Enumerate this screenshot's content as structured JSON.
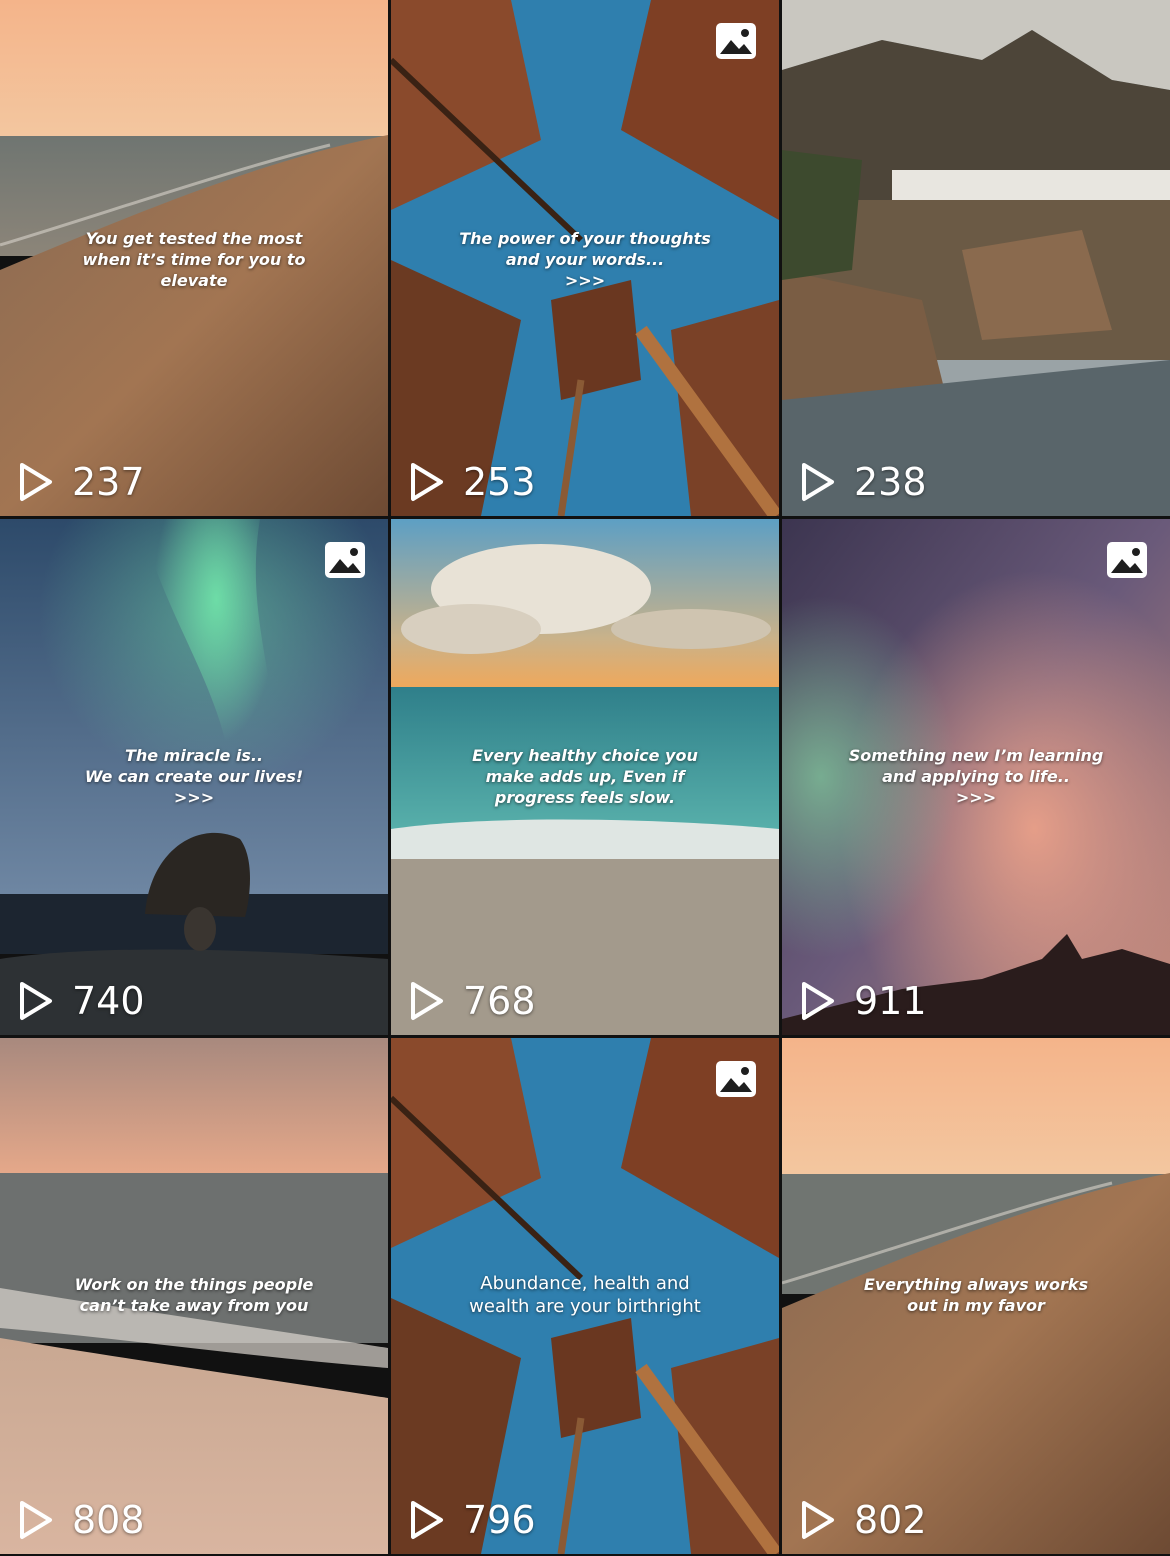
{
  "tiles": [
    {
      "caption": "You get tested the most\nwhen it’s time for you to\nelevate",
      "views": "237",
      "photo_badge": false
    },
    {
      "caption": "The power of your thoughts\nand your words...\n>>>",
      "views": "253",
      "photo_badge": true
    },
    {
      "caption": "",
      "views": "238",
      "photo_badge": false
    },
    {
      "caption": "The miracle is..\nWe can create our lives!\n>>>",
      "views": "740",
      "photo_badge": true
    },
    {
      "caption": "Every healthy choice you\nmake adds up, Even if\nprogress feels slow.",
      "views": "768",
      "photo_badge": false
    },
    {
      "caption": "Something new I’m learning\nand applying to life..\n>>>",
      "views": "911",
      "photo_badge": true
    },
    {
      "caption": "Work on the things people\ncan’t take away from you",
      "views": "808",
      "photo_badge": false
    },
    {
      "caption": "Abundance, health and\nwealth are your birthright",
      "views": "796",
      "photo_badge": true
    },
    {
      "caption": "Everything always works\nout in my favor",
      "views": "802",
      "photo_badge": false
    }
  ],
  "icons": {
    "play": "play-icon",
    "photo": "photo-carousel-icon"
  },
  "colors": {
    "text": "#ffffff",
    "grid_gap": "#111111"
  }
}
